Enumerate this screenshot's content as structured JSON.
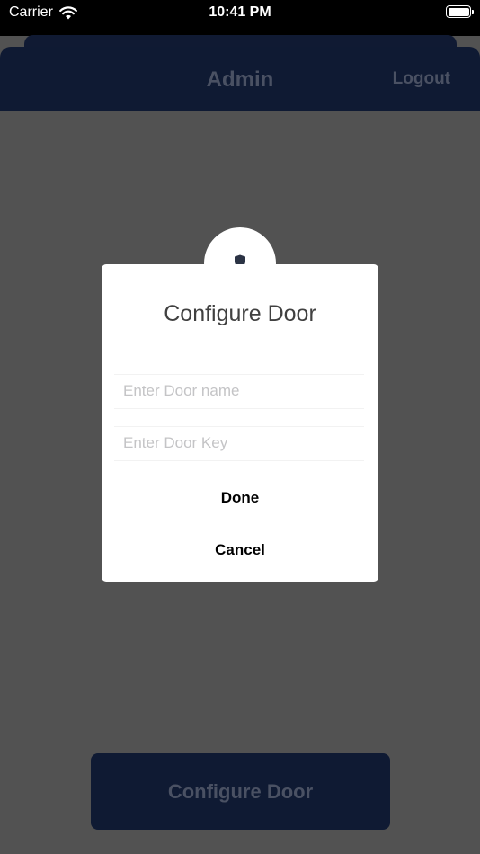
{
  "status_bar": {
    "carrier": "Carrier",
    "time": "10:41 PM"
  },
  "nav": {
    "title": "Admin",
    "logout_label": "Logout"
  },
  "modal": {
    "title": "Configure Door",
    "door_name_placeholder": "Enter Door name",
    "door_key_placeholder": "Enter Door Key",
    "done_label": "Done",
    "cancel_label": "Cancel",
    "badge_icon": "shield-icon"
  },
  "main": {
    "configure_button_label": "Configure Door"
  },
  "colors": {
    "nav_background": "#0f1a33",
    "overlay": "#525252",
    "modal_background": "#ffffff"
  }
}
